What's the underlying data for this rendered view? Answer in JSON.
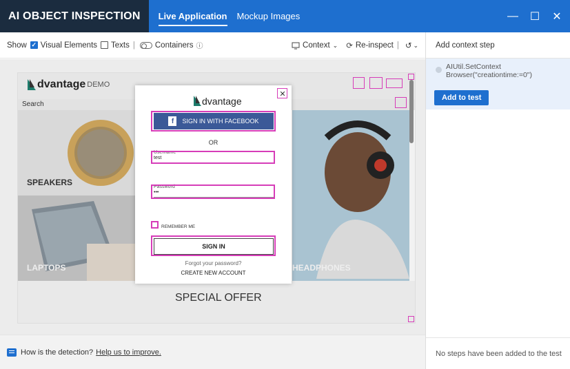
{
  "app": {
    "brand": "AI OBJECT INSPECTION",
    "tabs": [
      {
        "label": "Live Application",
        "active": true
      },
      {
        "label": "Mockup Images",
        "active": false
      }
    ],
    "window_controls": {
      "minimize": "—",
      "maximize": "☐",
      "close": "✕"
    }
  },
  "toolbar": {
    "show_label": "Show",
    "visual_elements": {
      "label": "Visual Elements",
      "checked": true
    },
    "texts": {
      "label": "Texts",
      "checked": false
    },
    "containers": {
      "label": "Containers",
      "on": false
    },
    "context_label": "Context",
    "reinspect_label": "Re-inspect"
  },
  "right_panel": {
    "header": "Add context step",
    "step_text_line1": "AIUtil.SetContext",
    "step_text_line2": "Browser(\"creationtime:=0\")",
    "add_button": "Add to test",
    "footer": "No steps have been added to the test"
  },
  "footer": {
    "question": "How is the detection?",
    "link": "Help us to improve."
  },
  "captured_app": {
    "logo_word": "dvantage",
    "logo_demo": "DEMO",
    "search_label": "Search",
    "categories": [
      "SPEAKERS",
      "LAPTOPS",
      "HEADPHONES"
    ],
    "special_offer": "SPECIAL OFFER",
    "modal": {
      "logo": "dvantage",
      "facebook_button": "SIGN IN WITH FACEBOOK",
      "facebook_letter": "f",
      "or_text": "OR",
      "username_label": "Username",
      "username_value": "test",
      "password_label": "Password",
      "password_value": "•••",
      "remember_label": "REMEMBER ME",
      "signin_button": "SIGN IN",
      "forgot_link": "Forgot your password?",
      "create_link": "CREATE NEW ACCOUNT"
    }
  },
  "colors": {
    "titlebar": "#1e6fcf",
    "brand_bg": "#1b2c3f",
    "highlight": "#d63cb8",
    "facebook": "#3b5998"
  }
}
